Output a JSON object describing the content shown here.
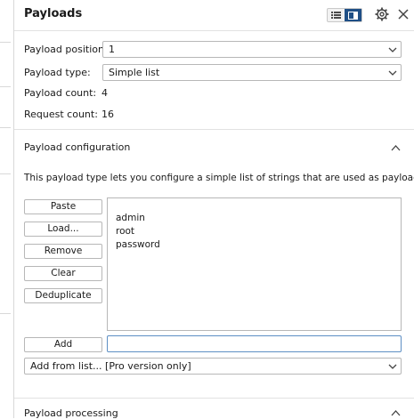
{
  "header": {
    "title": "Payloads"
  },
  "settings": {
    "position_label": "Payload position:",
    "position_value": "1",
    "type_label": "Payload type:",
    "type_value": "Simple list",
    "count_label": "Payload count:",
    "count_value": "4",
    "request_label": "Request count:",
    "request_value": "16"
  },
  "config": {
    "title": "Payload configuration",
    "description": "This payload type lets you configure a simple list of strings that are used as payloads.",
    "buttons": {
      "paste": "Paste",
      "load": "Load...",
      "remove": "Remove",
      "clear": "Clear",
      "deduplicate": "Deduplicate",
      "add": "Add"
    },
    "items": [
      "admin",
      "root",
      "password"
    ],
    "add_input_value": "",
    "add_from_list": "Add from list... [Pro version only]"
  },
  "processing": {
    "title": "Payload processing"
  },
  "icons": {
    "toggle_left": "list-view-icon",
    "toggle_right": "split-view-icon",
    "settings": "gear-icon",
    "close": "close-icon",
    "chevron": "chevron-down-icon",
    "collapse": "chevron-up-icon"
  },
  "colors": {
    "accent": "#1f4f86",
    "focus_border": "#5d8fc4"
  }
}
